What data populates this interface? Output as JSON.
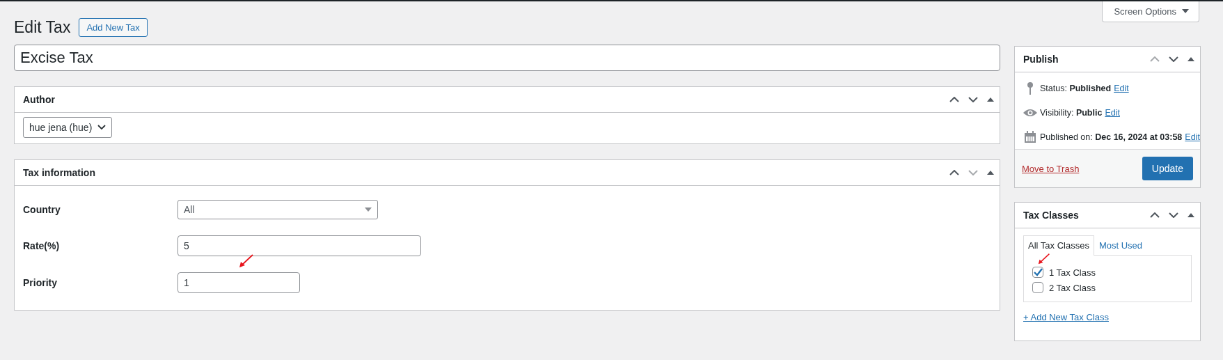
{
  "screen_options": {
    "label": "Screen Options"
  },
  "heading": "Edit Tax",
  "add_new_button": "Add New Tax",
  "title_field": {
    "value": "Excise Tax"
  },
  "main_boxes": [
    {
      "kind": "author",
      "title": "Author",
      "up_disabled": false,
      "down_disabled": false,
      "select_value": "hue jena (hue)"
    },
    {
      "kind": "fields",
      "title": "Tax information",
      "up_disabled": false,
      "down_disabled": true,
      "fields": [
        {
          "kind": "select",
          "label": "Country",
          "value": "All"
        },
        {
          "kind": "text",
          "label": "Rate(%)",
          "value": "5"
        },
        {
          "kind": "text",
          "label": "Priority",
          "value": "1",
          "annotated": true
        }
      ]
    }
  ],
  "publish": {
    "title": "Publish",
    "up_disabled": true,
    "down_disabled": false,
    "rows": [
      {
        "kind": "status",
        "text": "Status: **Published**",
        "link": "Edit"
      },
      {
        "kind": "visibility",
        "text": "Visibility: **Public**",
        "link": "Edit"
      },
      {
        "kind": "date",
        "text": "Published on: **Dec 16, 2024 at 03:58**",
        "link": "Edit"
      }
    ],
    "trash_link": "Move to Trash",
    "update_button": "Update"
  },
  "tax_classes": {
    "title": "Tax Classes",
    "up_disabled": false,
    "down_disabled": false,
    "tabs": [
      {
        "label": "All Tax Classes",
        "selected": true
      },
      {
        "label": "Most Used",
        "selected": false
      }
    ],
    "items": [
      {
        "label": "1 Tax Class",
        "checked": true,
        "annotated": true
      },
      {
        "label": "2 Tax Class",
        "checked": false,
        "annotated": false
      }
    ],
    "add_link": "+ Add New Tax Class"
  }
}
